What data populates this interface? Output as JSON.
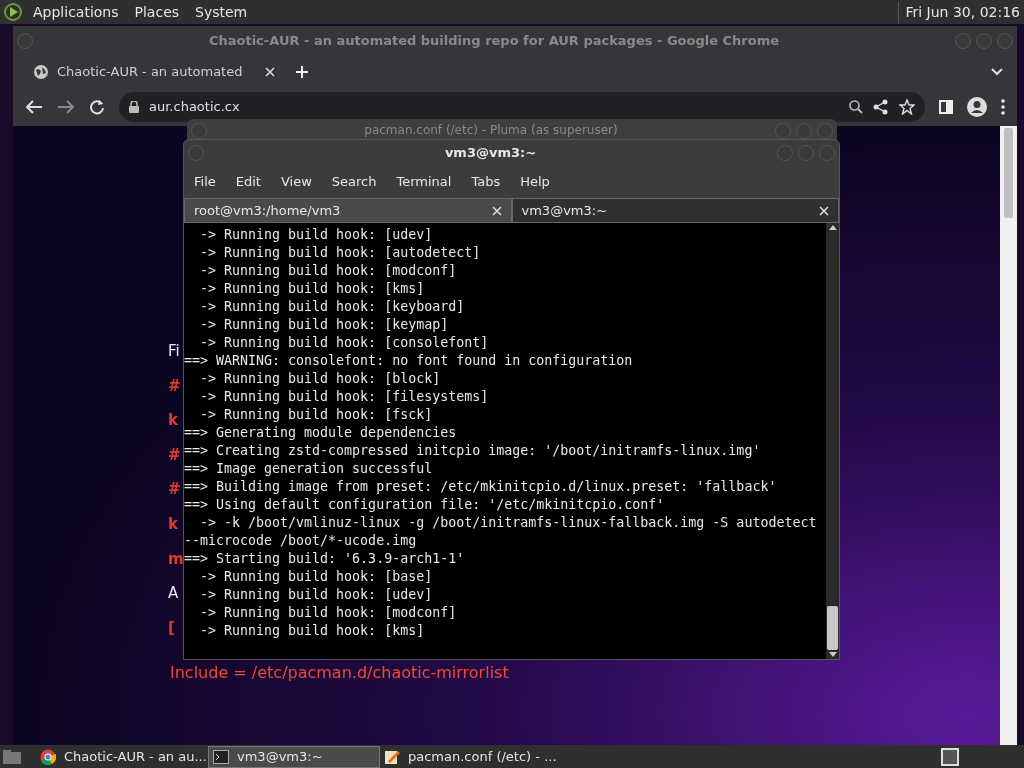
{
  "top_panel": {
    "menus": [
      "Applications",
      "Places",
      "System"
    ],
    "clock": "Fri Jun 30, 02:16"
  },
  "browser": {
    "title": "Chaotic-AUR - an automated building repo for AUR packages - Google Chrome",
    "tabs": [
      {
        "label": "Chaotic-AUR - an automated ",
        "selected": true
      }
    ],
    "address": "aur.chaotic.cx",
    "page_fragments": [
      {
        "text": "Fi",
        "kind": "plain"
      },
      {
        "text": "#",
        "kind": "accent"
      },
      {
        "text": "k",
        "kind": "accent"
      },
      {
        "text": "#",
        "kind": "accent"
      },
      {
        "text": "#",
        "kind": "accent"
      },
      {
        "text": "k",
        "kind": "accent"
      },
      {
        "text": "m",
        "kind": "accent"
      },
      {
        "text": "A",
        "kind": "plain"
      },
      {
        "text": "[",
        "kind": "accent"
      }
    ],
    "page_footer_line": "Include = /etc/pacman.d/chaotic-mirrorlist"
  },
  "editor_window": {
    "title": "pacman.conf (/etc) - Pluma (as superuser)"
  },
  "terminal": {
    "title": "vm3@vm3:~",
    "menus": [
      "File",
      "Edit",
      "View",
      "Search",
      "Terminal",
      "Tabs",
      "Help"
    ],
    "tabs": [
      {
        "label": "root@vm3:/home/vm3",
        "selected": false
      },
      {
        "label": "vm3@vm3:~",
        "selected": true
      }
    ],
    "lines": [
      "  -> Running build hook: [udev]",
      "  -> Running build hook: [autodetect]",
      "  -> Running build hook: [modconf]",
      "  -> Running build hook: [kms]",
      "  -> Running build hook: [keyboard]",
      "  -> Running build hook: [keymap]",
      "  -> Running build hook: [consolefont]",
      "==> WARNING: consolefont: no font found in configuration",
      "  -> Running build hook: [block]",
      "  -> Running build hook: [filesystems]",
      "  -> Running build hook: [fsck]",
      "==> Generating module dependencies",
      "==> Creating zstd-compressed initcpio image: '/boot/initramfs-linux.img'",
      "==> Image generation successful",
      "==> Building image from preset: /etc/mkinitcpio.d/linux.preset: 'fallback'",
      "==> Using default configuration file: '/etc/mkinitcpio.conf'",
      "  -> -k /boot/vmlinuz-linux -g /boot/initramfs-linux-fallback.img -S autodetect",
      "--microcode /boot/*-ucode.img",
      "==> Starting build: '6.3.9-arch1-1'",
      "  -> Running build hook: [base]",
      "  -> Running build hook: [udev]",
      "  -> Running build hook: [modconf]",
      "  -> Running build hook: [kms]"
    ]
  },
  "taskbar": {
    "items": [
      {
        "label": "Chaotic-AUR - an au...",
        "kind": "browser",
        "selected": false
      },
      {
        "label": "vm3@vm3:~",
        "kind": "terminal",
        "selected": true
      },
      {
        "label": "pacman.conf (/etc) - ...",
        "kind": "editor",
        "selected": false
      }
    ]
  }
}
